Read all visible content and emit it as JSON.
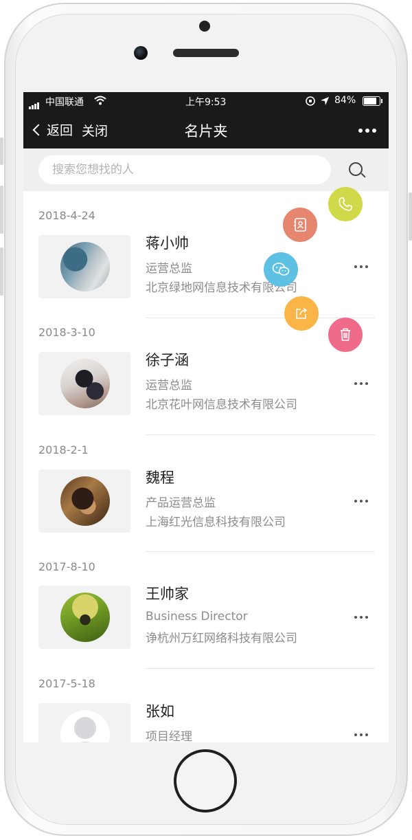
{
  "status_bar": {
    "carrier": "中国联通",
    "time": "上午9:53",
    "battery_percent": "84%",
    "battery_level": 0.84
  },
  "nav": {
    "back_label": "返回",
    "close_label": "关闭",
    "title": "名片夹"
  },
  "search": {
    "placeholder": "搜索您想找的人"
  },
  "cards": [
    {
      "date": "2018-4-24",
      "name": "蒋小帅",
      "title": "运营总监",
      "company": "北京绿地网信息技术有限公司"
    },
    {
      "date": "2018-3-10",
      "name": "徐子涵",
      "title": "运营总监",
      "company": "北京花叶网信息技术有限公司"
    },
    {
      "date": "2018-2-1",
      "name": "魏程",
      "title": "产品运营总监",
      "company": "上海红光信息科技有限公司"
    },
    {
      "date": "2017-8-10",
      "name": "王帅家",
      "title": "Business Director",
      "company": "诤杭州万红网络科技有限公司"
    },
    {
      "date": "2017-5-18",
      "name": "张如",
      "title": "项目经理",
      "company": ""
    }
  ],
  "quick_actions": {
    "colors": {
      "call": "#cfd94a",
      "contact": "#e6866e",
      "wechat": "#5ec0e3",
      "share": "#f9b545",
      "delete": "#f06a8a"
    },
    "icons": [
      "phone-icon",
      "contact-book-icon",
      "wechat-icon",
      "share-icon",
      "trash-icon"
    ]
  }
}
